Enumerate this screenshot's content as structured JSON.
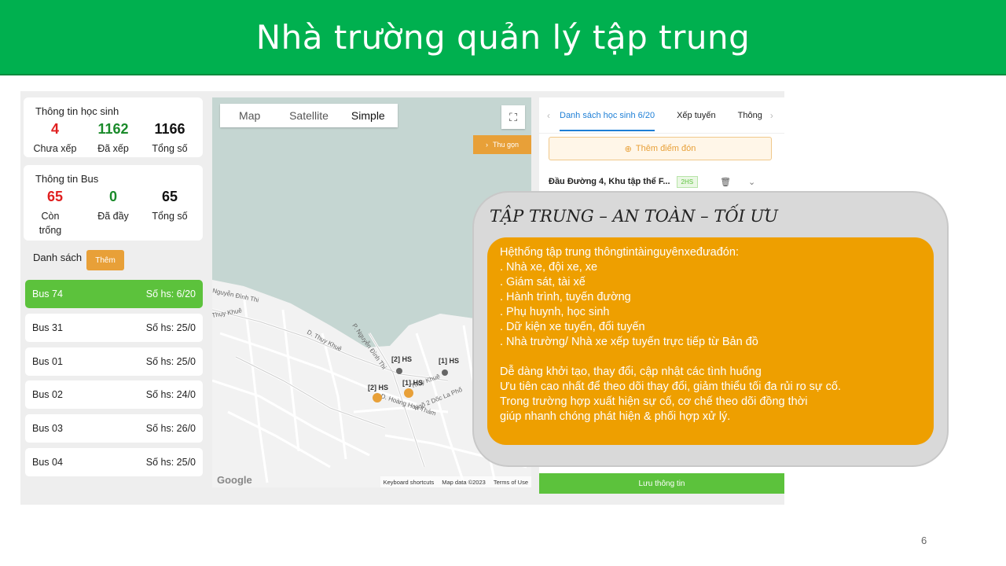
{
  "banner": {
    "title": "Nhà trường quản lý tập trung"
  },
  "students": {
    "title": "Thông tin học sinh",
    "stats": [
      {
        "value": "4",
        "label": "Chưa xếp",
        "color": "#e02020"
      },
      {
        "value": "1162",
        "label": "Đã xếp",
        "color": "#1a8a2a"
      },
      {
        "value": "1166",
        "label": "Tổng số",
        "color": "#111111"
      }
    ]
  },
  "buses": {
    "title": "Thông tin Bus",
    "stats": [
      {
        "value": "65",
        "label": "Còn trống",
        "color": "#e02020"
      },
      {
        "value": "0",
        "label": "Đã đầy",
        "color": "#1a8a2a"
      },
      {
        "value": "65",
        "label": "Tổng số",
        "color": "#111111"
      }
    ]
  },
  "list": {
    "label": "Danh sách",
    "add_label": "Thêm",
    "items": [
      {
        "name": "Bus 74",
        "count": "Số hs: 6/20"
      },
      {
        "name": "Bus 31",
        "count": "Số hs: 25/0"
      },
      {
        "name": "Bus 01",
        "count": "Số hs: 25/0"
      },
      {
        "name": "Bus 02",
        "count": "Số hs: 24/0"
      },
      {
        "name": "Bus 03",
        "count": "Số hs: 26/0"
      },
      {
        "name": "Bus 04",
        "count": "Số hs: 25/0"
      }
    ]
  },
  "map": {
    "tabs": [
      "Map",
      "Satellite",
      "Simple"
    ],
    "selected_tab": "Simple",
    "collapse_label": "Thu gọn",
    "streets": [
      "Nguyễn Đình Thi",
      "Thụy Khuê",
      "D. Thụy Khuê",
      "P. Nguyễn Đình Thi",
      "Ngõ 2 Dốc La Phố",
      "D. Hoàng Hoa Thám",
      "Thụy Khuê"
    ],
    "markers": [
      "[2] HS",
      "[1] HS",
      "[2] HS",
      "[1] HS"
    ],
    "footer": [
      "Keyboard shortcuts",
      "Map data ©2023",
      "Terms of Use"
    ],
    "logo": "Google"
  },
  "right_panel": {
    "tabs": [
      "Danh sách học sinh 6/20",
      "Xếp tuyến",
      "Thông"
    ],
    "pickup_label": "Thêm điểm đón",
    "route_title": "Đầu Đường 4, Khu tập thể F...",
    "route_badge": "2HS",
    "save_label": "Lưu thông tin"
  },
  "callout": {
    "title": "TẬP TRUNG – AN TOÀN – TỐI ƯU",
    "lines_1": [
      "Hệthống tập trung thôngtintàinguyênxeđưađón:",
      ". Nhà xe, đội xe, xe",
      ". Giám sát, tài xế",
      ". Hành trình, tuyến đường",
      ". Phụ huynh, học sinh",
      ". Dữ kiện xe tuyến, đổi tuyến",
      ". Nhà trường/ Nhà xe xếp tuyến trực tiếp từ Bản đồ"
    ],
    "lines_2": [
      "Dễ dàng khởi tạo, thay đổi, cập nhật các tình huống",
      "Ưu tiên cao nhất để theo dõi thay đổi, giảm thiểu tối đa rủi ro sự cố.",
      "Trong trường hợp xuất hiện sự cố, cơ chế theo dõi đồng thời",
      "giúp nhanh chóng phát hiện & phối hợp xử lý."
    ]
  },
  "page_number": "6"
}
